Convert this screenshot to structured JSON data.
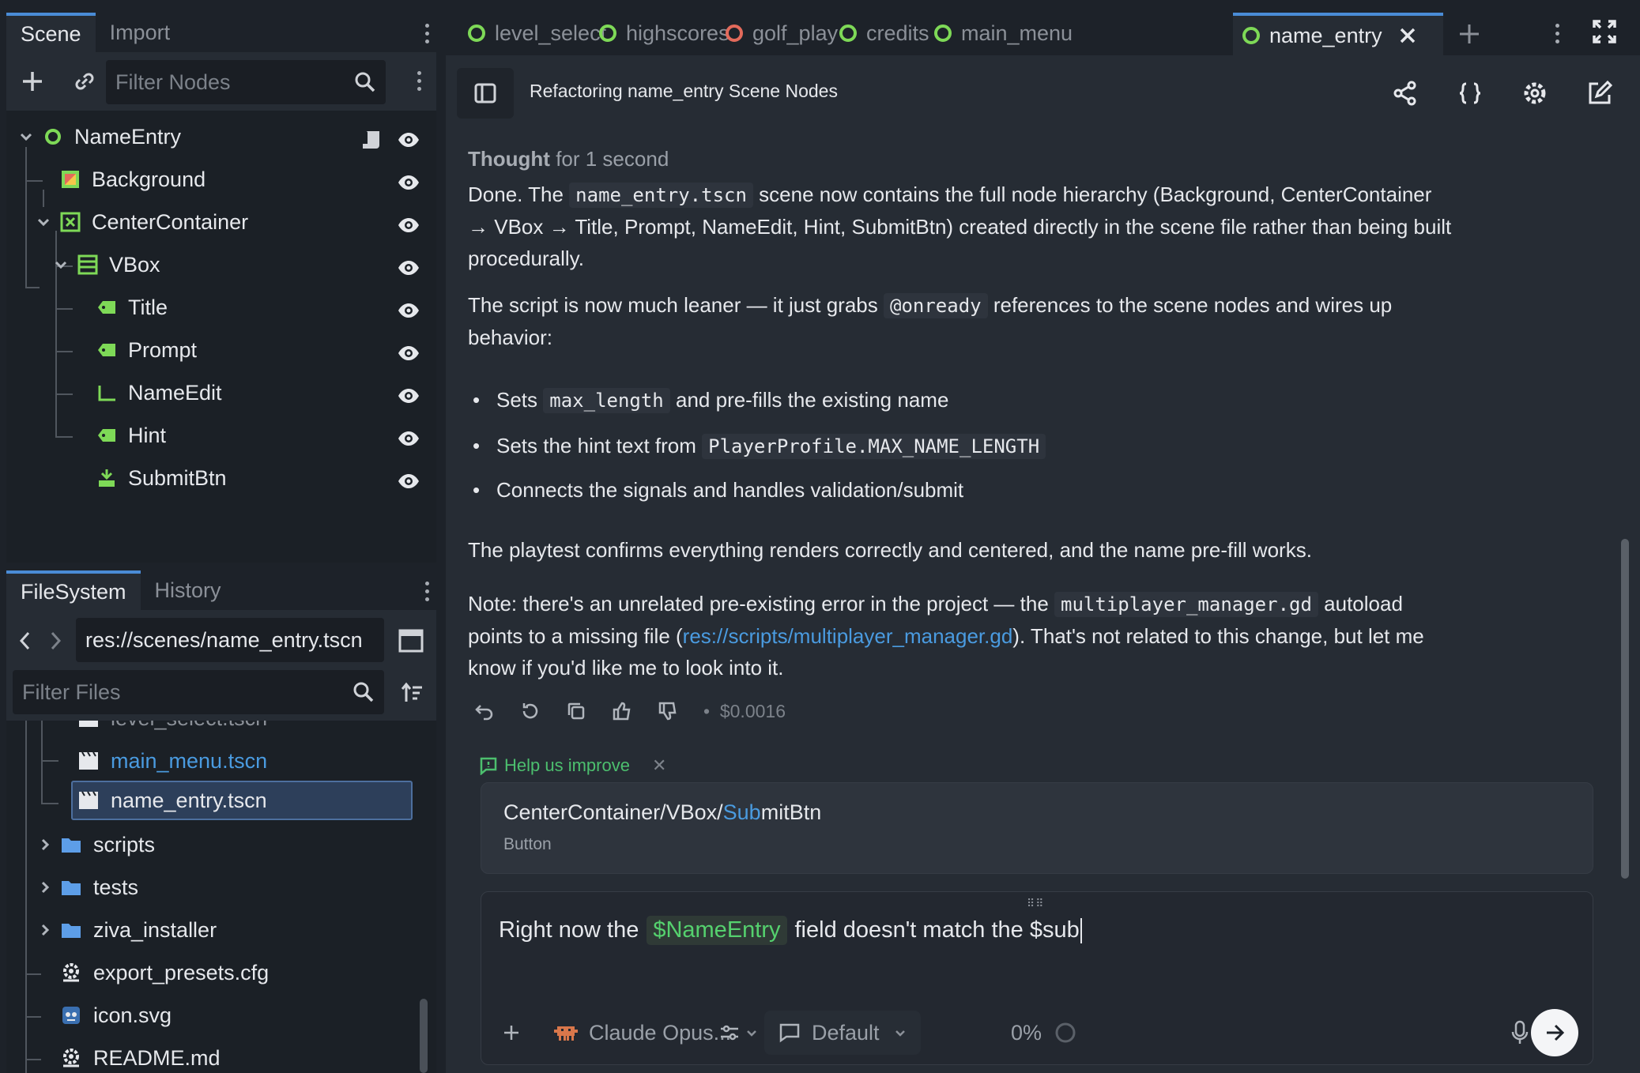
{
  "scene_dock": {
    "tabs": [
      "Scene",
      "Import"
    ],
    "filter_placeholder": "Filter Nodes",
    "nodes": [
      {
        "label": "NameEntry"
      },
      {
        "label": "Background"
      },
      {
        "label": "CenterContainer"
      },
      {
        "label": "VBox"
      },
      {
        "label": "Title"
      },
      {
        "label": "Prompt"
      },
      {
        "label": "NameEdit"
      },
      {
        "label": "Hint"
      },
      {
        "label": "SubmitBtn"
      }
    ]
  },
  "filesystem_dock": {
    "tabs": [
      "FileSystem",
      "History"
    ],
    "path": "res://scenes/name_entry.tscn",
    "filter_placeholder": "Filter Files",
    "items": [
      {
        "label": "level_select.tscn"
      },
      {
        "label": "main_menu.tscn"
      },
      {
        "label": "name_entry.tscn"
      },
      {
        "label": "scripts"
      },
      {
        "label": "tests"
      },
      {
        "label": "ziva_installer"
      },
      {
        "label": "export_presets.cfg"
      },
      {
        "label": "icon.svg"
      },
      {
        "label": "README.md"
      }
    ]
  },
  "editor_tabs": [
    {
      "label": "level_select",
      "status": "ok"
    },
    {
      "label": "highscores",
      "status": "ok"
    },
    {
      "label": "golf_play",
      "status": "error"
    },
    {
      "label": "credits",
      "status": "ok"
    },
    {
      "label": "main_menu",
      "status": "ok"
    },
    {
      "label": "name_entry",
      "status": "ok"
    }
  ],
  "chat": {
    "title": "Refactoring name_entry Scene Nodes",
    "thought_label": "Thought",
    "thought_duration": "for 1 second",
    "p1_a": "Done. The",
    "p1_code": "name_entry.tscn",
    "p1_b": "scene now contains the full node hierarchy (Background, CenterContainer",
    "p1_c": "→ VBox → Title, Prompt, NameEdit, Hint, SubmitBtn) created directly in the scene file rather than being built",
    "p1_d": "procedurally.",
    "p2_a": "The script is now much leaner — it just grabs",
    "p2_code": "@onready",
    "p2_b": "references to the scene nodes and wires up",
    "p2_c": "behavior:",
    "b1_a": "Sets",
    "b1_code": "max_length",
    "b1_b": "and pre-fills the existing name",
    "b2_a": "Sets the hint text from",
    "b2_code": "PlayerProfile.MAX_NAME_LENGTH",
    "b3": "Connects the signals and handles validation/submit",
    "p3": "The playtest confirms everything renders correctly and centered, and the name pre-fill works.",
    "p4_a": "Note: there's an unrelated pre-existing error in the project — the",
    "p4_code": "multiplayer_manager.gd",
    "p4_b": "autoload",
    "p4_c": "points to a missing file (",
    "p4_link": "res://scripts/multiplayer_manager.gd",
    "p4_d": "). That's not related to this change, but let me",
    "p4_e": "know if you'd like me to look into it.",
    "cost": "$0.0016",
    "help_label": "Help us improve",
    "context_path_a": "CenterContainer/VBox/",
    "context_path_hl": "Sub",
    "context_path_b": "mitBtn",
    "context_type": "Button",
    "input_a": "Right now the",
    "input_mention": "$NameEntry",
    "input_b": "field doesn't match the $sub",
    "model": "Claude Opus...",
    "mode": "Default",
    "context_pct": "0%"
  },
  "colors": {
    "accent": "#4a8cd6",
    "ok": "#7ed957",
    "error": "#e36a5b",
    "link": "#4a9be0",
    "mention": "#55d16e"
  }
}
